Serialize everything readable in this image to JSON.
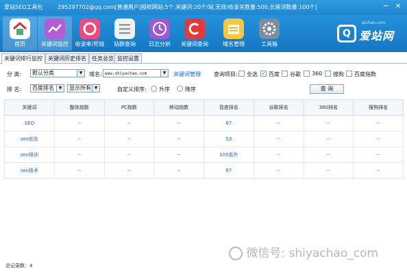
{
  "titlebar": {
    "app_title": "爱站SEO工具包",
    "info": "295297702@qq.com[普通用户]授权网站:5个,关键词:20个/站,无效/收录关数量:500,长尾词数量:100个]",
    "minimize": "─",
    "close": "✕"
  },
  "toolbar": {
    "items": [
      {
        "label": "首页",
        "icon": "home-icon",
        "color": "#ffffff"
      },
      {
        "label": "关键词监控",
        "icon": "chart-icon",
        "color": "#b45bd6"
      },
      {
        "label": "收录率/死链",
        "icon": "ring-icon",
        "color": "#ef4a7e"
      },
      {
        "label": "站群查询",
        "icon": "list-icon",
        "color": "#f2f2f2"
      },
      {
        "label": "日志分析",
        "icon": "clock-icon",
        "color": "#a05ad0"
      },
      {
        "label": "关键词查询",
        "icon": "c-icon",
        "color": "#e2393b"
      },
      {
        "label": "域名管理",
        "icon": "note-icon",
        "color": "#f5c842"
      },
      {
        "label": "工具箱",
        "icon": "gear-icon",
        "color": "#7d8f9f"
      }
    ]
  },
  "logo": {
    "text": "爱站网",
    "sub": "aizhan.com",
    "mark": "Q"
  },
  "tabs": [
    "关键词排行监控",
    "关键词历史排名",
    "任务总览",
    "监控设置"
  ],
  "filters": {
    "category_label": "分  类:",
    "category_value": "默认分类",
    "domain_label": "域名:",
    "domain_value": "www.shiyachao.com",
    "keyword_manage_link": "关键词管理",
    "query_items_label": "查询项目:",
    "checks": [
      {
        "label": "全选",
        "checked": false
      },
      {
        "label": "百度",
        "checked": true
      },
      {
        "label": "谷歌",
        "checked": false
      },
      {
        "label": "360",
        "checked": false
      },
      {
        "label": "搜狗",
        "checked": false
      },
      {
        "label": "百度指数",
        "checked": false
      }
    ],
    "rank_label": "排  名:",
    "rank_value": "百度排名",
    "show_value": "显示所有",
    "custom_sort_label": "自定义排序:",
    "sort_asc": "升序",
    "sort_desc": "降序",
    "query_button": "查 询"
  },
  "table": {
    "columns": [
      "关键词",
      "整体指数",
      "PC指数",
      "移动指数",
      "百度排名",
      "谷歌排名",
      "360排名",
      "搜狗排名"
    ],
    "rows": [
      [
        "SEO",
        "--",
        "--",
        "--",
        "67",
        "--",
        "--",
        "--"
      ],
      [
        "seo创业",
        "--",
        "--",
        "--",
        "53",
        "--",
        "--",
        "--"
      ],
      [
        "seo培训",
        "--",
        "--",
        "--",
        "100名外",
        "--",
        "--",
        "--"
      ],
      [
        "seo技术",
        "--",
        "--",
        "--",
        "67",
        "--",
        "--",
        "--"
      ]
    ]
  },
  "footer": {
    "total_label": "总记录数：4"
  },
  "watermark": {
    "text": "微信号: shiyachao_com"
  }
}
